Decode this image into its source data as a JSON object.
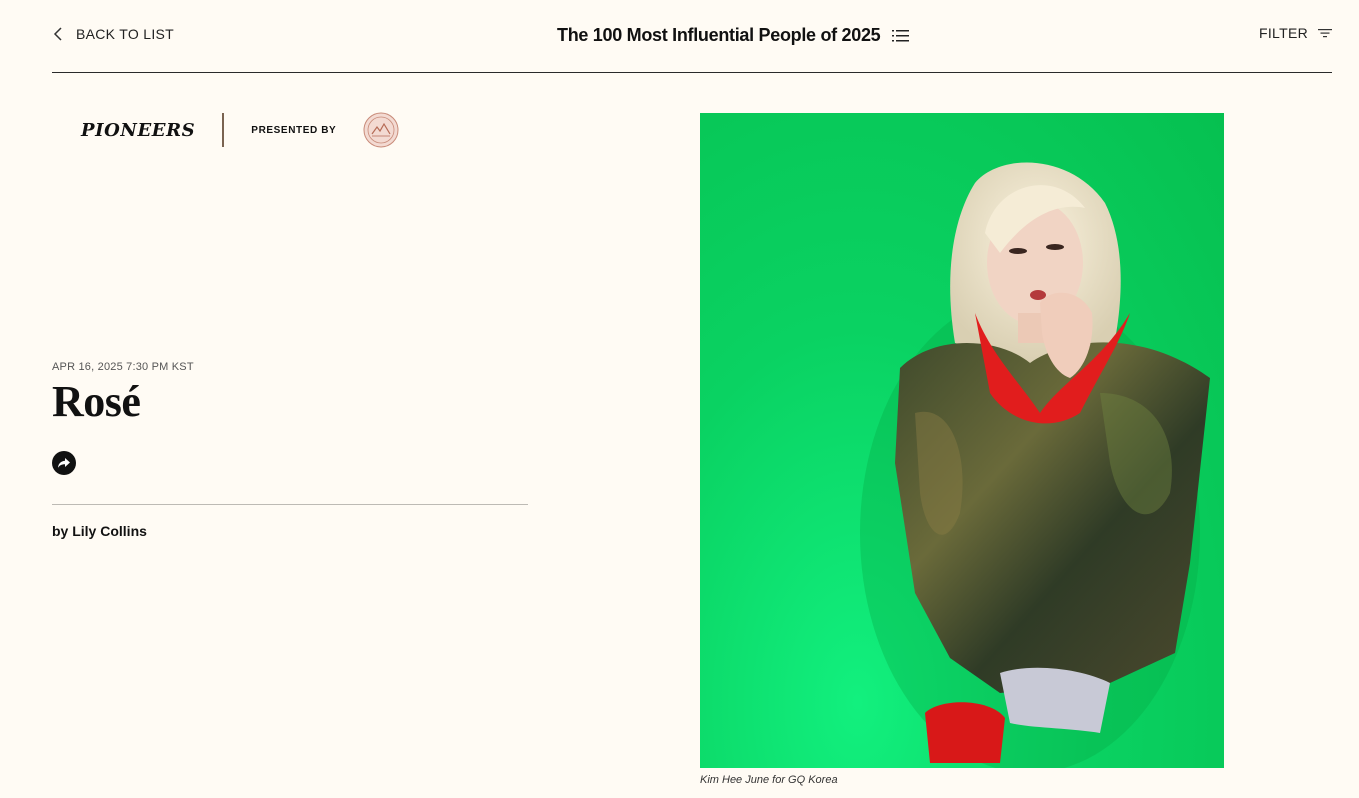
{
  "header": {
    "back_label": "BACK TO LIST",
    "title": "The 100 Most Influential People of 2025",
    "filter_label": "FILTER"
  },
  "sponsor": {
    "category": "PIONEERS",
    "presented_by": "PRESENTED BY",
    "logo_icon": "sponsor-seal-icon"
  },
  "article": {
    "date": "APR 16, 2025 7:30 PM KST",
    "name": "Rosé",
    "byline": "by Lily Collins"
  },
  "photo": {
    "caption": "Kim Hee June for GQ Korea"
  },
  "colors": {
    "background": "#fffbf4",
    "photo_background": "#0ad262",
    "text": "#111111",
    "divider": "#7a6350"
  }
}
